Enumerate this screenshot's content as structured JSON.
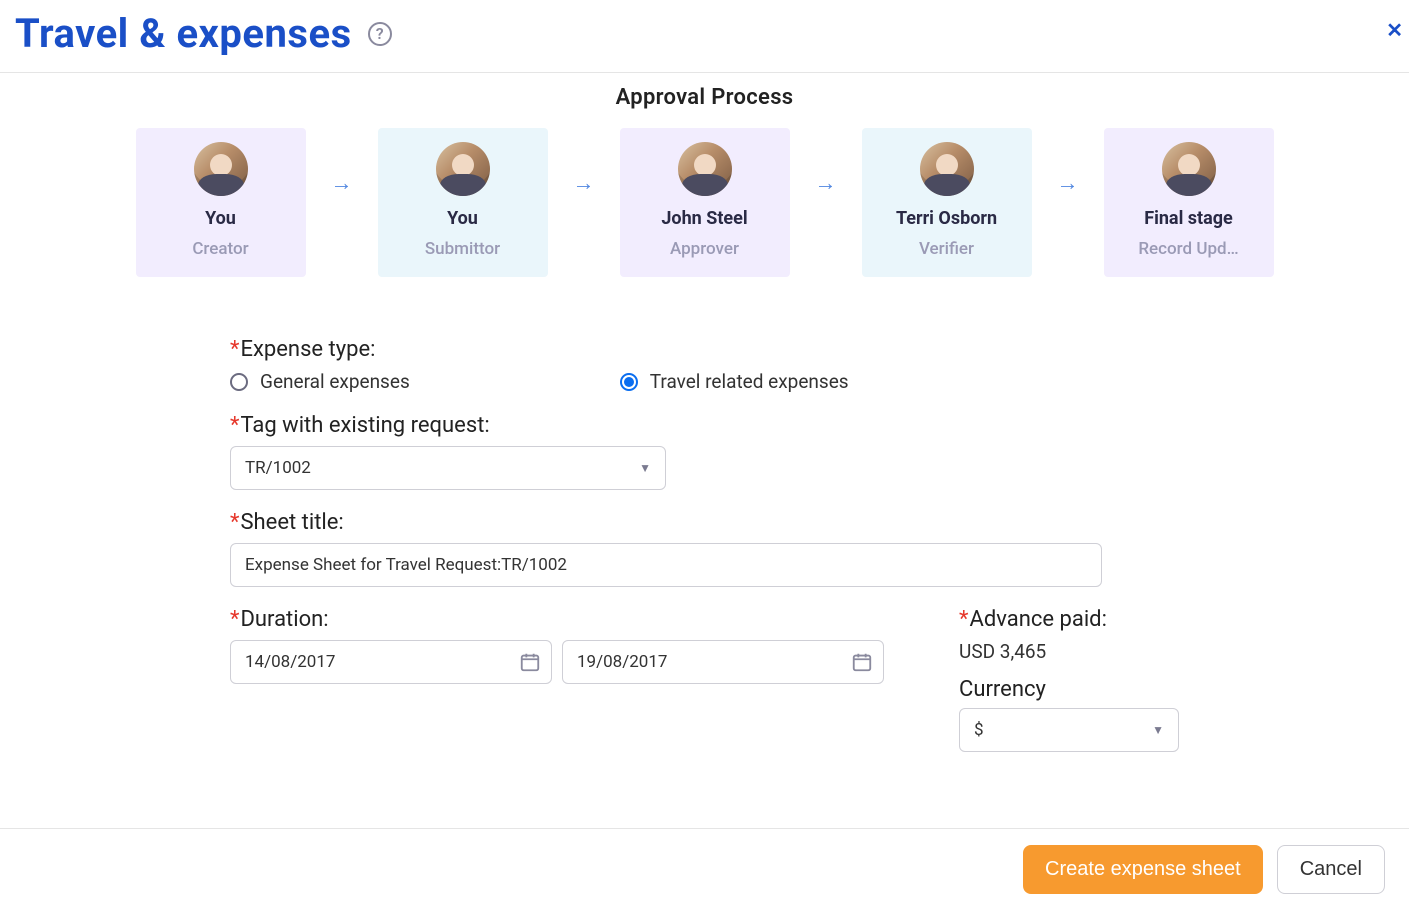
{
  "header": {
    "title": "Travel & expenses",
    "help_tooltip": "?",
    "close_label": "✕"
  },
  "approval": {
    "section_title": "Approval Process",
    "stages": [
      {
        "name": "You",
        "role": "Creator",
        "variant": "purple"
      },
      {
        "name": "You",
        "role": "Submittor",
        "variant": "blue"
      },
      {
        "name": "John Steel",
        "role": "Approver",
        "variant": "purple"
      },
      {
        "name": "Terri Osborn",
        "role": "Verifier",
        "variant": "blue"
      },
      {
        "name": "Final stage",
        "role": "Record Upd…",
        "variant": "purple"
      }
    ]
  },
  "form": {
    "expense_type": {
      "label": "Expense type:",
      "options": {
        "general": "General expenses",
        "travel": "Travel related expenses"
      },
      "selected": "travel"
    },
    "tag_request": {
      "label": "Tag with existing request:",
      "value": "TR/1002"
    },
    "sheet_title": {
      "label": "Sheet title:",
      "value": "Expense Sheet for Travel Request:TR/1002"
    },
    "duration": {
      "label": "Duration:",
      "from": "14/08/2017",
      "to": "19/08/2017"
    },
    "advance_paid": {
      "label": "Advance paid:",
      "value": "USD 3,465"
    },
    "currency": {
      "label": "Currency",
      "value": "$"
    }
  },
  "footer": {
    "primary": "Create expense sheet",
    "secondary": "Cancel"
  }
}
